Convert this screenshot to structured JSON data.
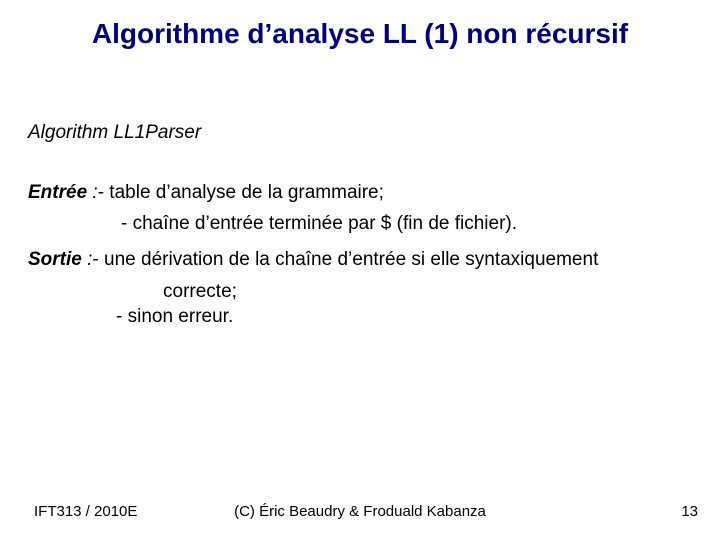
{
  "title": "Algorithme d’analyse LL (1) non récursif",
  "algo_name": "Algorithm LL1Parser",
  "entree": {
    "label_bold": "Entrée",
    "label_rest": " :  ",
    "line1": "- table d’analyse de la grammaire;",
    "line2": "- chaîne d’entrée terminée par $ (fin de fichier)."
  },
  "sortie": {
    "label_bold": "Sortie",
    "label_rest": " :  ",
    "line1": "- une dérivation de la chaîne d’entrée si elle syntaxiquement",
    "line2": "correcte;",
    "line3": "- sinon erreur."
  },
  "footer": {
    "left": "IFT313 / 2010E",
    "center": "(C) Éric Beaudry & Froduald Kabanza",
    "right": "13"
  }
}
